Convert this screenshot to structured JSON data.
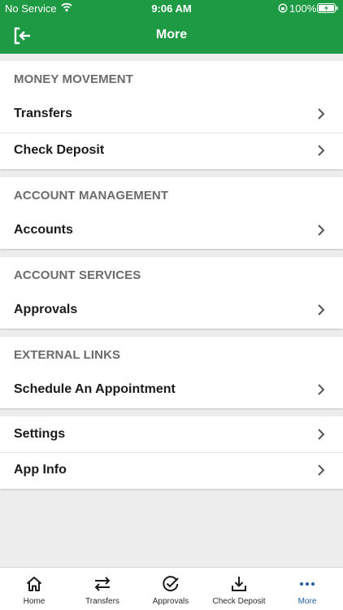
{
  "status_bar": {
    "carrier": "No Service",
    "time": "9:06 AM",
    "battery": "100%"
  },
  "header": {
    "title": "More",
    "back_icon": "logout-arrow-icon"
  },
  "sections": [
    {
      "header": "MONEY MOVEMENT",
      "items": [
        {
          "label": "Transfers"
        },
        {
          "label": "Check Deposit"
        }
      ]
    },
    {
      "header": "ACCOUNT MANAGEMENT",
      "items": [
        {
          "label": "Accounts"
        }
      ]
    },
    {
      "header": "ACCOUNT SERVICES",
      "items": [
        {
          "label": "Approvals"
        }
      ]
    },
    {
      "header": "EXTERNAL LINKS",
      "items": [
        {
          "label": "Schedule An Appointment"
        }
      ]
    },
    {
      "header": "",
      "items": [
        {
          "label": "Settings"
        },
        {
          "label": "App Info"
        }
      ]
    }
  ],
  "tabbar": {
    "tabs": [
      {
        "label": "Home",
        "icon": "home-icon"
      },
      {
        "label": "Transfers",
        "icon": "transfer-arrows-icon"
      },
      {
        "label": "Approvals",
        "icon": "check-circle-icon"
      },
      {
        "label": "Check Deposit",
        "icon": "download-tray-icon"
      },
      {
        "label": "More",
        "icon": "more-dots-icon",
        "active": true
      }
    ]
  },
  "colors": {
    "brand_green": "#1f9a44",
    "active_tab": "#1f5f9e",
    "section_header": "#6b6b6b",
    "background": "#ededed"
  }
}
